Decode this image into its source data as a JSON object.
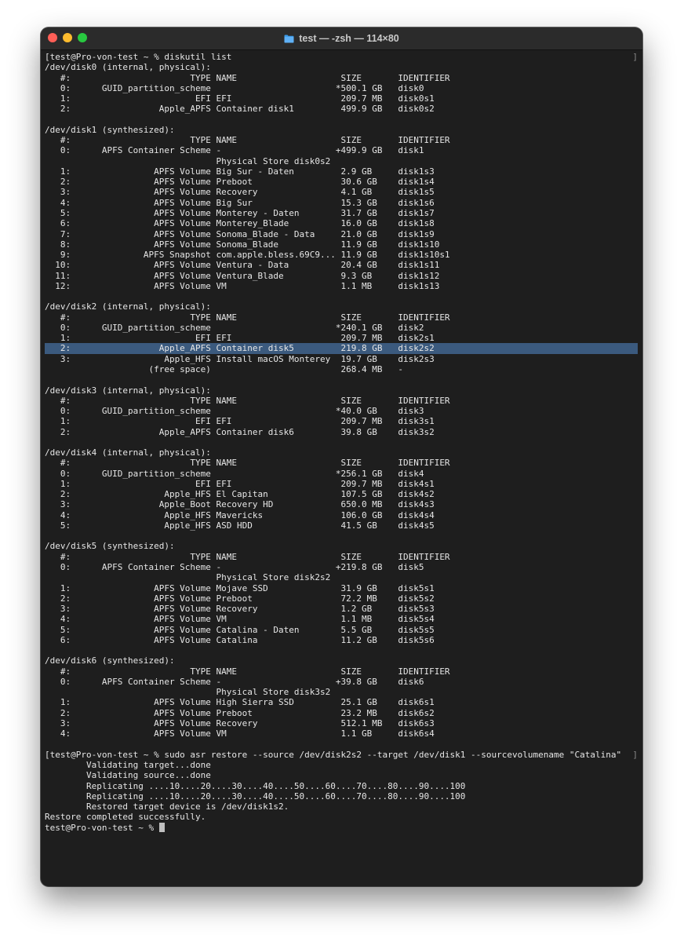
{
  "window": {
    "title": "test — -zsh — 114×80"
  },
  "terminal": {
    "lines": [
      {
        "text": "[test@Pro-von-test ~ % diskutil list",
        "bracket": true
      },
      {
        "text": "/dev/disk0 (internal, physical):"
      },
      {
        "text": "   #:                       TYPE NAME                    SIZE       IDENTIFIER"
      },
      {
        "text": "   0:      GUID_partition_scheme                        *500.1 GB   disk0"
      },
      {
        "text": "   1:                        EFI EFI                     209.7 MB   disk0s1"
      },
      {
        "text": "   2:                 Apple_APFS Container disk1         499.9 GB   disk0s2"
      },
      {
        "text": ""
      },
      {
        "text": "/dev/disk1 (synthesized):"
      },
      {
        "text": "   #:                       TYPE NAME                    SIZE       IDENTIFIER"
      },
      {
        "text": "   0:      APFS Container Scheme -                      +499.9 GB   disk1"
      },
      {
        "text": "                                 Physical Store disk0s2"
      },
      {
        "text": "   1:                APFS Volume Big Sur - Daten         2.9 GB     disk1s3"
      },
      {
        "text": "   2:                APFS Volume Preboot                 30.6 GB    disk1s4"
      },
      {
        "text": "   3:                APFS Volume Recovery                4.1 GB     disk1s5"
      },
      {
        "text": "   4:                APFS Volume Big Sur                 15.3 GB    disk1s6"
      },
      {
        "text": "   5:                APFS Volume Monterey - Daten        31.7 GB    disk1s7"
      },
      {
        "text": "   6:                APFS Volume Monterey_Blade          16.0 GB    disk1s8"
      },
      {
        "text": "   7:                APFS Volume Sonoma_Blade - Data     21.0 GB    disk1s9"
      },
      {
        "text": "   8:                APFS Volume Sonoma_Blade            11.9 GB    disk1s10"
      },
      {
        "text": "   9:              APFS Snapshot com.apple.bless.69C9... 11.9 GB    disk1s10s1"
      },
      {
        "text": "  10:                APFS Volume Ventura - Data          20.4 GB    disk1s11"
      },
      {
        "text": "  11:                APFS Volume Ventura_Blade           9.3 GB     disk1s12"
      },
      {
        "text": "  12:                APFS Volume VM                      1.1 MB     disk1s13"
      },
      {
        "text": ""
      },
      {
        "text": "/dev/disk2 (internal, physical):"
      },
      {
        "text": "   #:                       TYPE NAME                    SIZE       IDENTIFIER"
      },
      {
        "text": "   0:      GUID_partition_scheme                        *240.1 GB   disk2"
      },
      {
        "text": "   1:                        EFI EFI                     209.7 MB   disk2s1"
      },
      {
        "text": "   2:                 Apple_APFS Container disk5         219.8 GB   disk2s2",
        "highlight": true
      },
      {
        "text": "   3:                  Apple_HFS Install macOS Monterey  19.7 GB    disk2s3"
      },
      {
        "text": "                    (free space)                         268.4 MB   -"
      },
      {
        "text": ""
      },
      {
        "text": "/dev/disk3 (internal, physical):"
      },
      {
        "text": "   #:                       TYPE NAME                    SIZE       IDENTIFIER"
      },
      {
        "text": "   0:      GUID_partition_scheme                        *40.0 GB    disk3"
      },
      {
        "text": "   1:                        EFI EFI                     209.7 MB   disk3s1"
      },
      {
        "text": "   2:                 Apple_APFS Container disk6         39.8 GB    disk3s2"
      },
      {
        "text": ""
      },
      {
        "text": "/dev/disk4 (internal, physical):"
      },
      {
        "text": "   #:                       TYPE NAME                    SIZE       IDENTIFIER"
      },
      {
        "text": "   0:      GUID_partition_scheme                        *256.1 GB   disk4"
      },
      {
        "text": "   1:                        EFI EFI                     209.7 MB   disk4s1"
      },
      {
        "text": "   2:                  Apple_HFS El Capitan              107.5 GB   disk4s2"
      },
      {
        "text": "   3:                 Apple_Boot Recovery HD             650.0 MB   disk4s3"
      },
      {
        "text": "   4:                  Apple_HFS Mavericks               106.0 GB   disk4s4"
      },
      {
        "text": "   5:                  Apple_HFS ASD HDD                 41.5 GB    disk4s5"
      },
      {
        "text": ""
      },
      {
        "text": "/dev/disk5 (synthesized):"
      },
      {
        "text": "   #:                       TYPE NAME                    SIZE       IDENTIFIER"
      },
      {
        "text": "   0:      APFS Container Scheme -                      +219.8 GB   disk5"
      },
      {
        "text": "                                 Physical Store disk2s2"
      },
      {
        "text": "   1:                APFS Volume Mojave SSD              31.9 GB    disk5s1"
      },
      {
        "text": "   2:                APFS Volume Preboot                 72.2 MB    disk5s2"
      },
      {
        "text": "   3:                APFS Volume Recovery                1.2 GB     disk5s3"
      },
      {
        "text": "   4:                APFS Volume VM                      1.1 MB     disk5s4"
      },
      {
        "text": "   5:                APFS Volume Catalina - Daten        5.5 GB     disk5s5"
      },
      {
        "text": "   6:                APFS Volume Catalina                11.2 GB    disk5s6"
      },
      {
        "text": ""
      },
      {
        "text": "/dev/disk6 (synthesized):"
      },
      {
        "text": "   #:                       TYPE NAME                    SIZE       IDENTIFIER"
      },
      {
        "text": "   0:      APFS Container Scheme -                      +39.8 GB    disk6"
      },
      {
        "text": "                                 Physical Store disk3s2"
      },
      {
        "text": "   1:                APFS Volume High Sierra SSD         25.1 GB    disk6s1"
      },
      {
        "text": "   2:                APFS Volume Preboot                 23.2 MB    disk6s2"
      },
      {
        "text": "   3:                APFS Volume Recovery                512.1 MB   disk6s3"
      },
      {
        "text": "   4:                APFS Volume VM                      1.1 GB     disk6s4"
      },
      {
        "text": ""
      },
      {
        "text": "[test@Pro-von-test ~ % sudo asr restore --source /dev/disk2s2 --target /dev/disk1 --sourcevolumename \"Catalina\"",
        "bracket": true
      },
      {
        "text": "        Validating target...done"
      },
      {
        "text": "        Validating source...done"
      },
      {
        "text": "        Replicating ....10....20....30....40....50....60....70....80....90....100"
      },
      {
        "text": "        Replicating ....10....20....30....40....50....60....70....80....90....100"
      },
      {
        "text": "        Restored target device is /dev/disk1s2."
      },
      {
        "text": "Restore completed successfully."
      },
      {
        "text": "test@Pro-von-test ~ % ",
        "cursor": true
      }
    ]
  },
  "colors": {
    "background": "#1e1e1e",
    "text": "#e6e6e6",
    "highlight": "#3b5a7e",
    "close": "#ff5f57",
    "minimize": "#febc2e",
    "zoom": "#28c840"
  },
  "icons": {
    "title": "folder-icon",
    "cursor": "block-cursor"
  }
}
